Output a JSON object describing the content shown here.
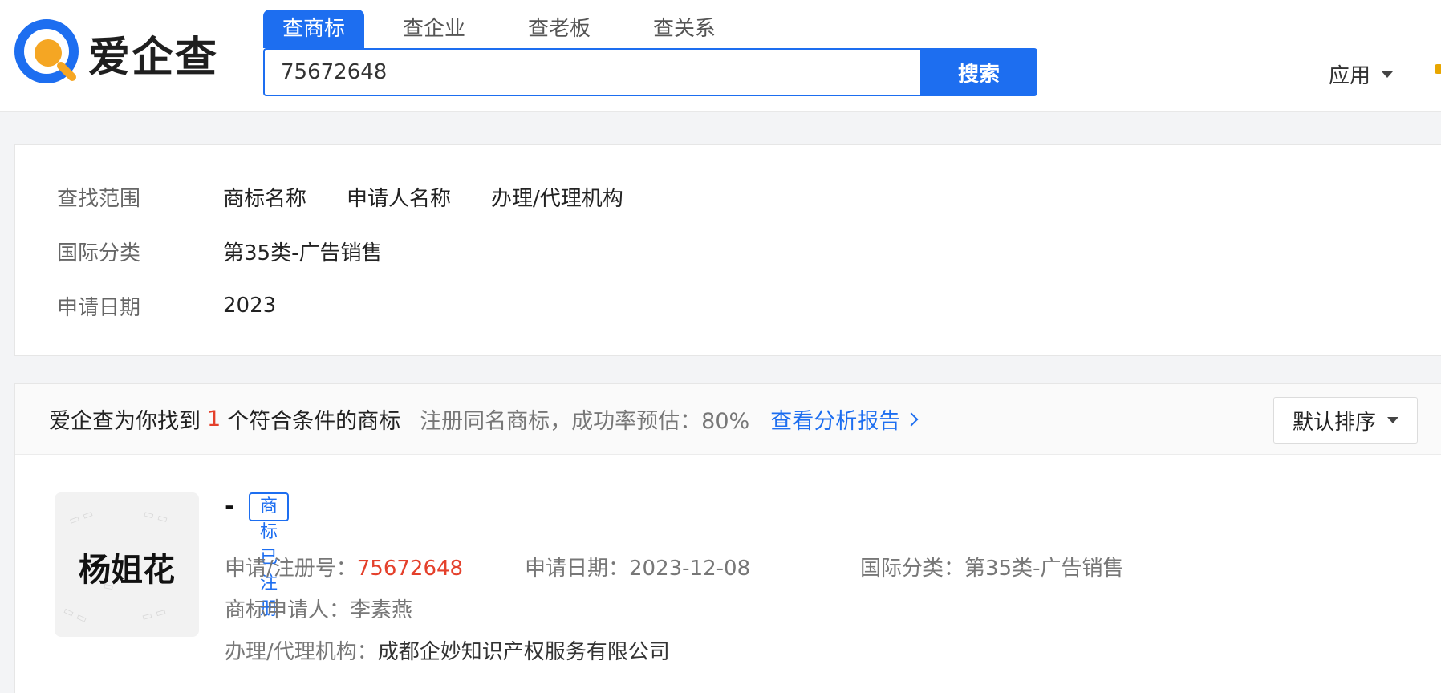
{
  "header": {
    "logo_text": "爱企查",
    "search_tabs": [
      "查商标",
      "查企业",
      "查老板",
      "查关系"
    ],
    "search_value": "75672648",
    "search_button": "搜索",
    "apps_label": "应用"
  },
  "filters": {
    "scope_label": "查找范围",
    "scope_options": [
      "商标名称",
      "申请人名称",
      "办理/代理机构"
    ],
    "class_label": "国际分类",
    "class_value": "第35类-广告销售",
    "date_label": "申请日期",
    "date_value": "2023"
  },
  "results": {
    "summary_prefix": "爱企查为你找到",
    "count": "1",
    "summary_suffix": "个符合条件的商标",
    "hint": "注册同名商标，成功率预估：80%",
    "report_link": "查看分析报告",
    "sort_label": "默认排序"
  },
  "trademark": {
    "image_text": "杨姐花",
    "name": "-",
    "status": "商标已注册",
    "reg_no_label": "申请/注册号：",
    "reg_no": "75672648",
    "date_label": "申请日期：",
    "date": "2023-12-08",
    "class_label": "国际分类：",
    "class": "第35类-广告销售",
    "applicant_label": "商标申请人：",
    "applicant": "李素燕",
    "agency_label": "办理/代理机构：",
    "agency": "成都企妙知识产权服务有限公司"
  },
  "colors": {
    "brand_blue": "#1d6ef0",
    "highlight_red": "#e4402b",
    "logo_orange": "#f5a623"
  }
}
